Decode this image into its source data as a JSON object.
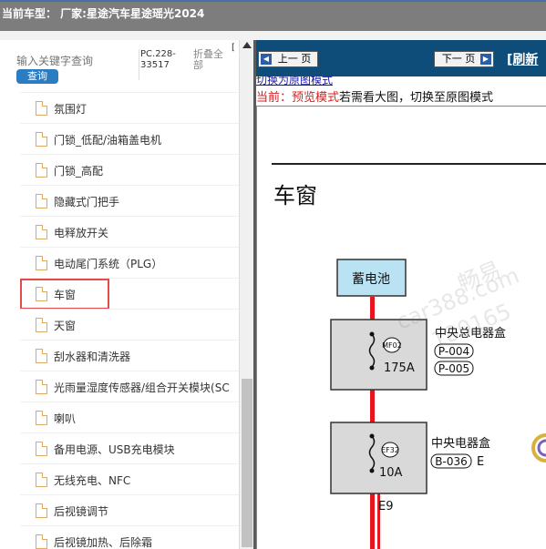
{
  "titlebar": {
    "text": "当前车型：  厂家:星途汽车星途瑶光2024"
  },
  "left_panel": {
    "search_placeholder": "输入关键字查询",
    "search_button": "查询",
    "pc_code": "PC.228-33517",
    "collapse_all": "折叠全部",
    "collapse_bracket": "[",
    "tree_items": [
      "氛围灯",
      "门锁_低配/油箱盖电机",
      "门锁_高配",
      "隐藏式门把手",
      "电释放开关",
      "电动尾门系统（PLG）",
      "车窗",
      "天窗",
      "刮水器和清洗器",
      "光雨量湿度传感器/组合开关模块(SC",
      "喇叭",
      "备用电源、USB充电模块",
      "无线充电、NFC",
      "后视镜调节",
      "后视镜加热、后除霜"
    ],
    "selected_item": "车窗"
  },
  "toolbar": {
    "prev_label": "上一 页",
    "next_label": "下一 页",
    "refresh_label": "[刷新"
  },
  "content": {
    "switch_link": "切换为原图模式",
    "mode_prefix": "当前：预览模式",
    "mode_suffix": "若需看大图，切换至原图模式",
    "doc_title": "车窗"
  },
  "diagram": {
    "battery_label": "蓄电池",
    "fuse1_id": "MF02",
    "fuse1_rating": "175A",
    "box1_name": "中央总电器盒",
    "box1_conn1": "P-004",
    "box1_conn2": "P-005",
    "fuse2_id": "EF32",
    "fuse2_rating": "10A",
    "box2_name": "中央电器盒",
    "box2_conn": "B-036",
    "box2_pin": "E",
    "wire_label": "E9",
    "wire_color": "#e8141e",
    "box_fill": "#d9d9d9",
    "battery_fill": "#b9e3f2"
  },
  "watermark": {
    "line1": "畅易",
    "line2": "car388.com",
    "line3": "180165"
  }
}
